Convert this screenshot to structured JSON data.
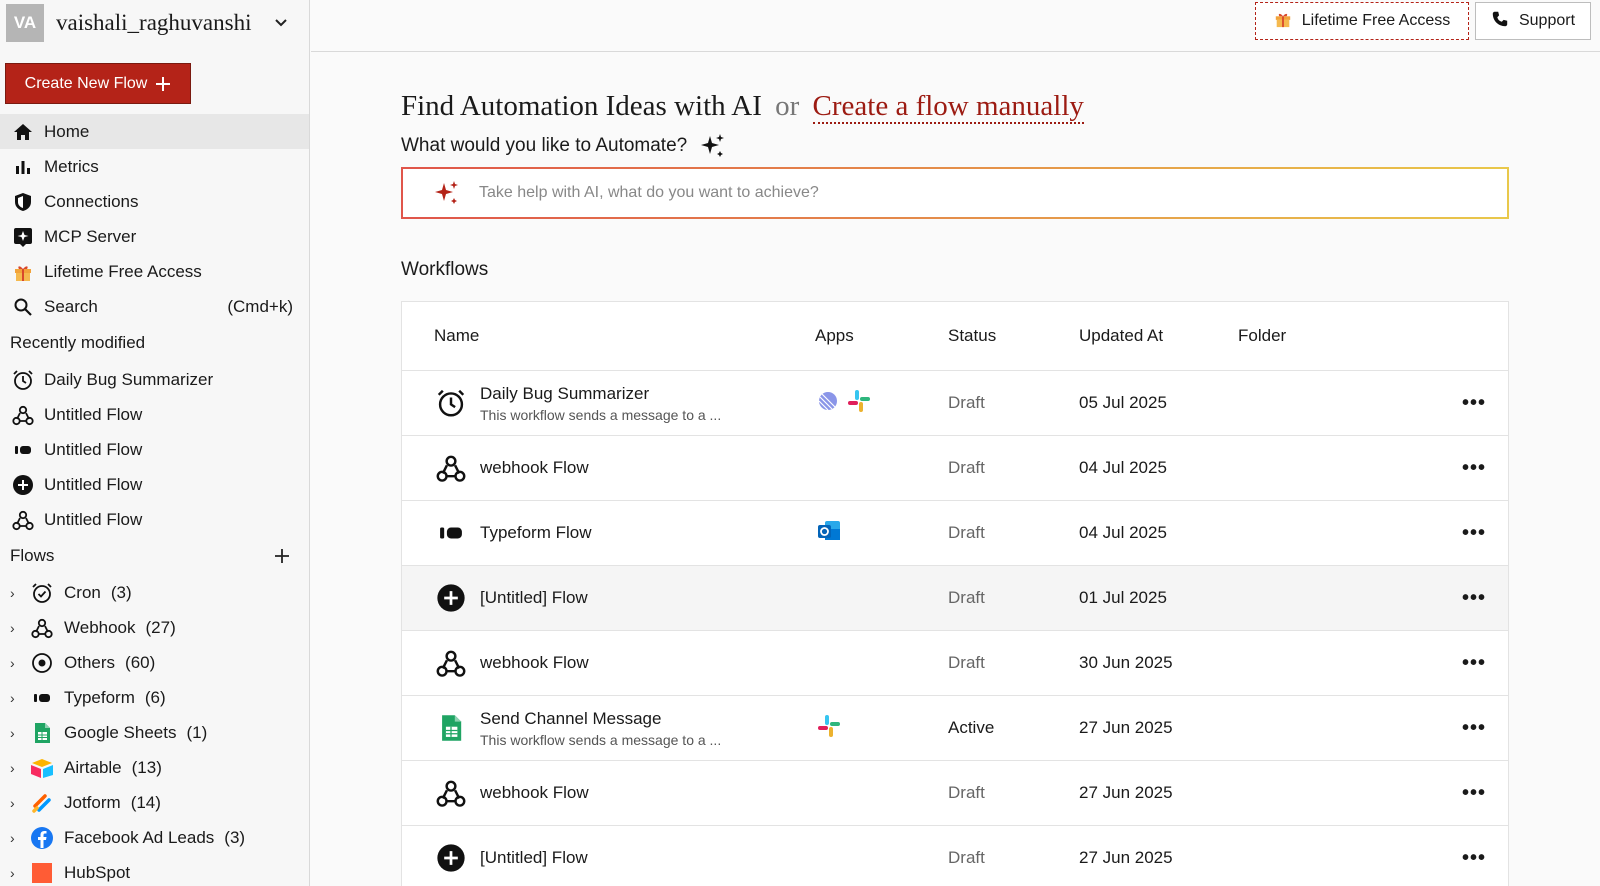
{
  "sidebar": {
    "avatar_initials": "VA",
    "username": "vaishali_raghuvanshi",
    "create_button": "Create New Flow",
    "nav": [
      {
        "label": "Home",
        "icon": "home-icon"
      },
      {
        "label": "Metrics",
        "icon": "bar-chart-icon"
      },
      {
        "label": "Connections",
        "icon": "shield-icon"
      },
      {
        "label": "MCP Server",
        "icon": "mcp-icon"
      },
      {
        "label": "Lifetime Free Access",
        "icon": "gift-icon"
      },
      {
        "label": "Search",
        "icon": "search-icon",
        "shortcut": "(Cmd+k)"
      }
    ],
    "recent_title": "Recently modified",
    "recent": [
      {
        "label": "Daily Bug Summarizer",
        "icon": "alarm-clock-icon"
      },
      {
        "label": "Untitled Flow",
        "icon": "webhook-icon"
      },
      {
        "label": "Untitled Flow",
        "icon": "typeform-icon"
      },
      {
        "label": "Untitled Flow",
        "icon": "plus-circle-icon"
      },
      {
        "label": "Untitled Flow",
        "icon": "webhook-icon"
      }
    ],
    "flows_title": "Flows",
    "folders": [
      {
        "label": "Cron",
        "count": "(3)",
        "icon": "alarm-clock-icon"
      },
      {
        "label": "Webhook",
        "count": "(27)",
        "icon": "webhook-icon"
      },
      {
        "label": "Others",
        "count": "(60)",
        "icon": "target-icon"
      },
      {
        "label": "Typeform",
        "count": "(6)",
        "icon": "typeform-icon"
      },
      {
        "label": "Google Sheets",
        "count": "(1)",
        "icon": "google-sheets-icon"
      },
      {
        "label": "Airtable",
        "count": "(13)",
        "icon": "airtable-icon"
      },
      {
        "label": "Jotform",
        "count": "(14)",
        "icon": "jotform-icon"
      },
      {
        "label": "Facebook Ad Leads",
        "count": "(3)",
        "icon": "facebook-icon"
      },
      {
        "label": "HubSpot",
        "count": "",
        "icon": "hubspot-icon"
      }
    ]
  },
  "topbar": {
    "lifetime_label": "Lifetime Free Access",
    "support_label": "Support"
  },
  "main": {
    "heading_ai": "Find Automation Ideas with AI",
    "heading_or": "or",
    "heading_manual": "Create a flow manually",
    "subheading": "What would you like to Automate?",
    "ai_placeholder": "Take help with AI, what do you want to achieve?",
    "workflows_title": "Workflows",
    "columns": [
      "Name",
      "Apps",
      "Status",
      "Updated At",
      "Folder"
    ],
    "rows": [
      {
        "icon": "alarm-clock-icon",
        "title": "Daily Bug Summarizer",
        "desc": "This workflow sends a message to a ...",
        "apps": [
          "linear-icon",
          "slack-icon"
        ],
        "status": "Draft",
        "updated": "05 Jul 2025"
      },
      {
        "icon": "webhook-icon",
        "title": "webhook Flow",
        "desc": "",
        "apps": [],
        "status": "Draft",
        "updated": "04 Jul 2025"
      },
      {
        "icon": "typeform-icon",
        "title": "Typeform Flow",
        "desc": "",
        "apps": [
          "outlook-icon"
        ],
        "status": "Draft",
        "updated": "04 Jul 2025"
      },
      {
        "icon": "plus-circle-icon",
        "title": "[Untitled] Flow",
        "desc": "",
        "apps": [],
        "status": "Draft",
        "updated": "01 Jul 2025"
      },
      {
        "icon": "webhook-icon",
        "title": "webhook Flow",
        "desc": "",
        "apps": [],
        "status": "Draft",
        "updated": "30 Jun 2025"
      },
      {
        "icon": "google-sheets-icon",
        "title": "Send Channel Message",
        "desc": "This workflow sends a message to a ...",
        "apps": [
          "slack-icon"
        ],
        "status": "Active",
        "updated": "27 Jun 2025"
      },
      {
        "icon": "webhook-icon",
        "title": "webhook Flow",
        "desc": "",
        "apps": [],
        "status": "Draft",
        "updated": "27 Jun 2025"
      },
      {
        "icon": "plus-circle-icon",
        "title": "[Untitled] Flow",
        "desc": "",
        "apps": [],
        "status": "Draft",
        "updated": "27 Jun 2025"
      }
    ],
    "more_label": "•••"
  },
  "colors": {
    "brand": "#b42318",
    "accent_dark": "#9c1b12"
  }
}
